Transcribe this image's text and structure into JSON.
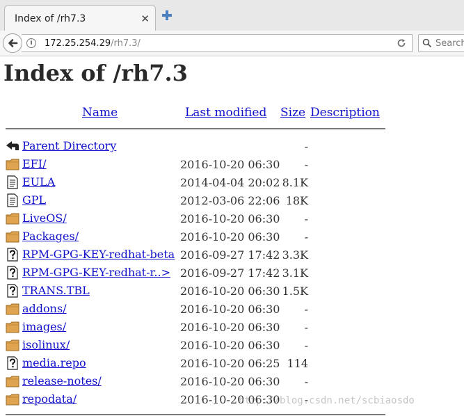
{
  "browser": {
    "tab_title": "Index of /rh7.3",
    "tab_close": "✕",
    "url_host": "172.25.254.29",
    "url_path": "/rh7.3/",
    "info_glyph": "i",
    "search_placeholder": "Search"
  },
  "page": {
    "heading": "Index of /rh7.3",
    "columns": {
      "name": "Name",
      "modified": "Last modified",
      "size": "Size",
      "description": "Description"
    },
    "rows": [
      {
        "icon": "parent-dir-icon",
        "name": "Parent Directory",
        "modified": "",
        "size": "-"
      },
      {
        "icon": "folder-icon",
        "name": "EFI/",
        "modified": "2016-10-20 06:30",
        "size": "-"
      },
      {
        "icon": "text-file-icon",
        "name": "EULA",
        "modified": "2014-04-04 20:02",
        "size": "8.1K"
      },
      {
        "icon": "text-file-icon",
        "name": "GPL",
        "modified": "2012-03-06 22:06",
        "size": "18K"
      },
      {
        "icon": "folder-icon",
        "name": "LiveOS/",
        "modified": "2016-10-20 06:30",
        "size": "-"
      },
      {
        "icon": "folder-icon",
        "name": "Packages/",
        "modified": "2016-10-20 06:30",
        "size": "-"
      },
      {
        "icon": "unknown-file-icon",
        "name": "RPM-GPG-KEY-redhat-beta",
        "modified": "2016-09-27 17:42",
        "size": "3.3K"
      },
      {
        "icon": "unknown-file-icon",
        "name": "RPM-GPG-KEY-redhat-r..>",
        "modified": "2016-09-27 17:42",
        "size": "3.1K"
      },
      {
        "icon": "unknown-file-icon",
        "name": "TRANS.TBL",
        "modified": "2016-10-20 06:30",
        "size": "1.5K"
      },
      {
        "icon": "folder-icon",
        "name": "addons/",
        "modified": "2016-10-20 06:30",
        "size": "-"
      },
      {
        "icon": "folder-icon",
        "name": "images/",
        "modified": "2016-10-20 06:30",
        "size": "-"
      },
      {
        "icon": "folder-icon",
        "name": "isolinux/",
        "modified": "2016-10-20 06:30",
        "size": "-"
      },
      {
        "icon": "unknown-file-icon",
        "name": "media.repo",
        "modified": "2016-10-20 06:25",
        "size": "114"
      },
      {
        "icon": "folder-icon",
        "name": "release-notes/",
        "modified": "2016-10-20 06:30",
        "size": "-"
      },
      {
        "icon": "folder-icon",
        "name": "repodata/",
        "modified": "2016-10-20 06:30",
        "size": "-"
      }
    ],
    "watermark": "http://blog.csdn.net/scbiaosdo"
  },
  "colors": {
    "link": "#1111cc",
    "folder": "#e0a450",
    "chrome_bg": "#e8e8e8"
  }
}
